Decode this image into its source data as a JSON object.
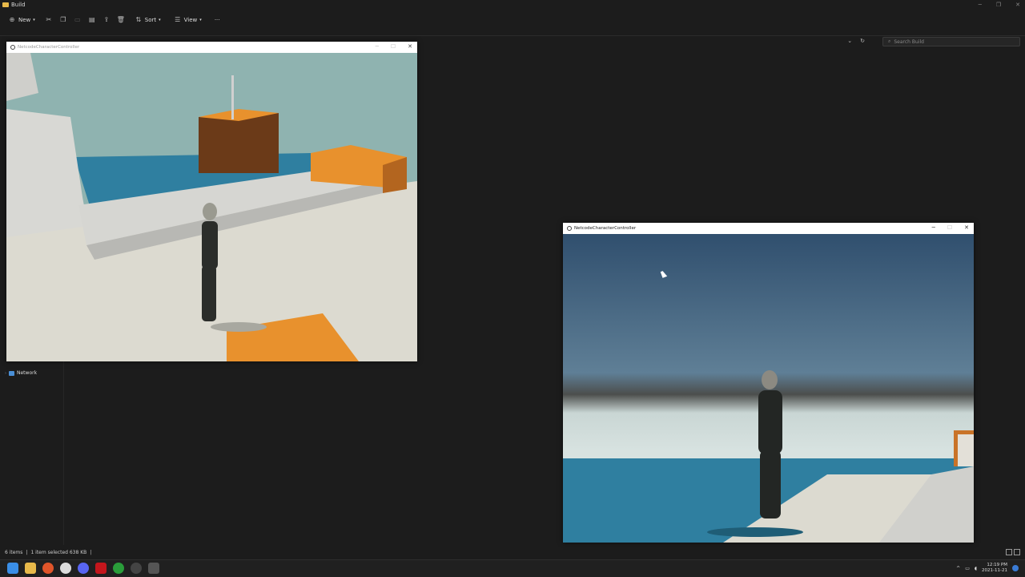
{
  "explorer": {
    "title": "Build",
    "toolbar": {
      "new_label": "New",
      "sort_label": "Sort",
      "view_label": "View",
      "more_label": "···"
    },
    "search_placeholder": "Search Build",
    "nav": {
      "network_label": "Network"
    },
    "status": {
      "items_count": "6 items",
      "selection": "1 item selected  638 KB"
    }
  },
  "game_windows": [
    {
      "title": "NetcodeCharacterController"
    },
    {
      "title": "NetcodeCharacterController"
    }
  ],
  "taskbar": {
    "time": "12:19 PM",
    "date": "2021-11-21",
    "apps": [
      "start-icon",
      "file-explorer-icon",
      "firefox-icon",
      "chrome-icon",
      "discord-icon",
      "app-red-icon",
      "xbox-icon",
      "unity-hub-icon",
      "unity-player-icon"
    ]
  },
  "colors": {
    "sky": "#8fb3b0",
    "water": "#2f7fa0",
    "orange": "#e8912d",
    "floor": "#dcdad0",
    "explorer_bg": "#1c1c1c"
  }
}
